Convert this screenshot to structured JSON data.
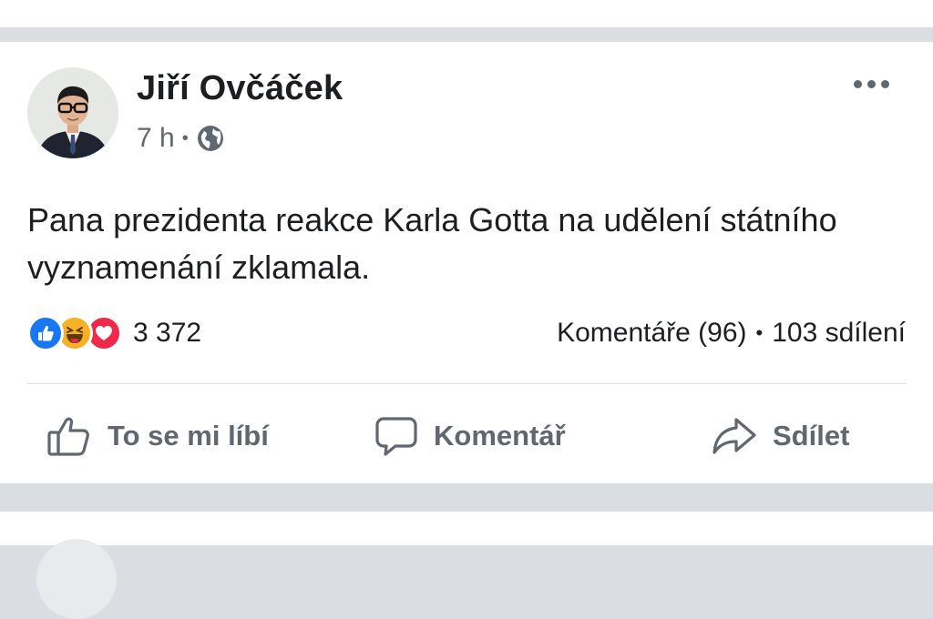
{
  "post": {
    "author": "Jiří Ovčáček",
    "time": "7 h",
    "meta_separator": "•",
    "privacy_icon": "globe-icon",
    "text": "Pana prezidenta reakce Karla Gotta na udělení státního vyznamenání zklamala.",
    "reactions": {
      "icons": [
        "like-reaction-icon",
        "haha-reaction-icon",
        "love-reaction-icon"
      ],
      "count": "3 372"
    },
    "comments_label": "Komentáře (96)",
    "stats_separator": "•",
    "shares_label": "103 sdílení"
  },
  "actions": {
    "like_label": "To se mi líbí",
    "comment_label": "Komentář",
    "share_label": "Sdílet"
  },
  "colors": {
    "like_blue": "#1877f2",
    "haha_yellow": "#f7b125",
    "love_red": "#f0284a",
    "secondary_text": "#606770",
    "page_background": "#dadde1"
  }
}
